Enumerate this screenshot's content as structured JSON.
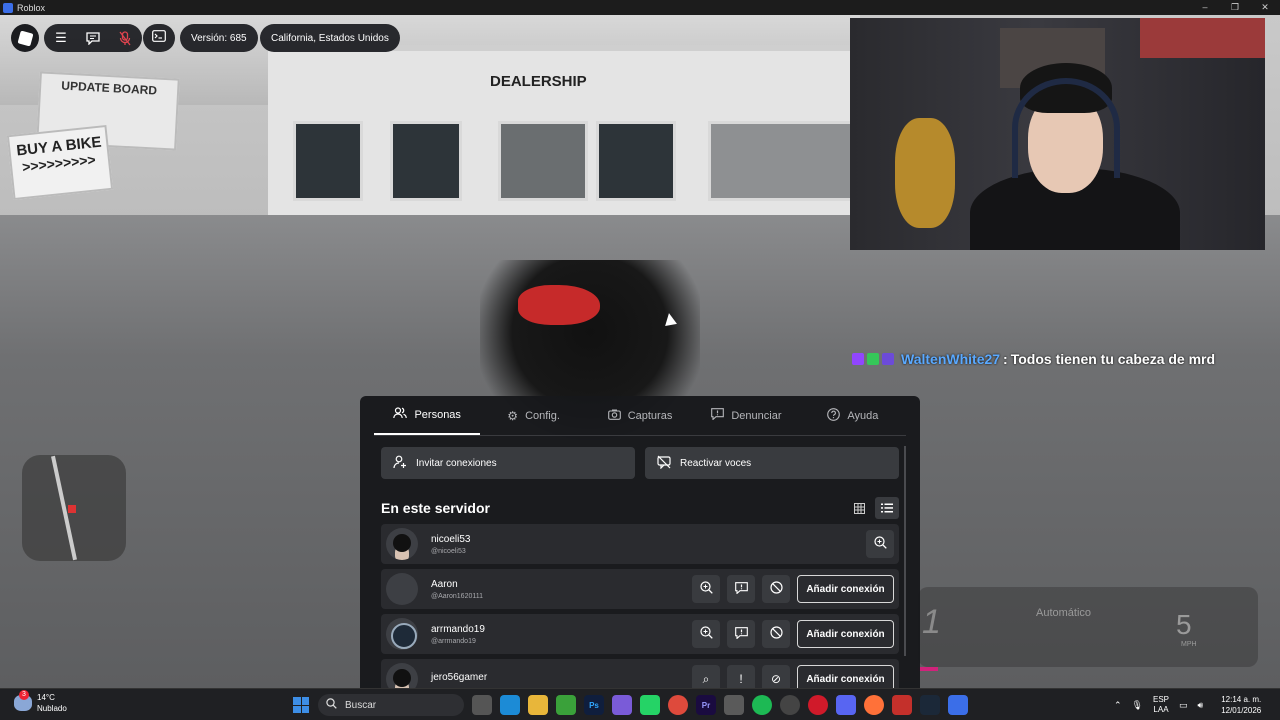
{
  "window": {
    "title": "Roblox"
  },
  "hud": {
    "version": "Versión: 685",
    "region": "California, Estados Unidos",
    "icons": [
      "roblox-logo-icon",
      "menu-icon",
      "chat-icon",
      "microphone-muted-icon",
      "console-icon"
    ]
  },
  "scene": {
    "dealership_sign": "DEALERSHIP",
    "update_board": "UPDATE BOARD",
    "bike_sign_title": "BUY A BIKE",
    "bike_sign_arrows": ">>>>>>>>>",
    "speedometer": {
      "mode": "Automático",
      "gear": "1",
      "speed": "5",
      "unit": "MPH"
    }
  },
  "chat": {
    "username": "WaltenWhite27",
    "separator": ":",
    "message": "Todos tienen tu cabeza de mrd",
    "badge_colors": [
      "#9146ff",
      "#35c759",
      "#6c4bd8"
    ]
  },
  "menu": {
    "tabs": [
      {
        "label": "Personas",
        "icon": "people-icon",
        "active": true
      },
      {
        "label": "Config.",
        "icon": "gear-icon",
        "active": false
      },
      {
        "label": "Capturas",
        "icon": "camera-icon",
        "active": false
      },
      {
        "label": "Denunciar",
        "icon": "report-icon",
        "active": false
      },
      {
        "label": "Ayuda",
        "icon": "help-icon",
        "active": false
      }
    ],
    "invite_label": "Invitar conexiones",
    "voice_label": "Reactivar voces",
    "section_title": "En este servidor",
    "players": [
      {
        "display": "nicoeli53",
        "username": "@nicoeli53"
      },
      {
        "display": "Aaron",
        "username": "@Aaron1620111"
      },
      {
        "display": "arrmando19",
        "username": "@arrmando19"
      },
      {
        "display": "jero56gamer",
        "username": ""
      }
    ],
    "add_label": "Añadir conexión"
  },
  "taskbar": {
    "temperature": "14°C",
    "condition": "Nublado",
    "notification_count": "3",
    "search_placeholder": "Buscar",
    "lang_top": "ESP",
    "lang_bottom": "LAA",
    "time": "12:14 a. m.",
    "date": "12/01/2026"
  },
  "colors": {
    "accent_blue": "#5aa9ff",
    "panel_bg": "#17181b"
  }
}
